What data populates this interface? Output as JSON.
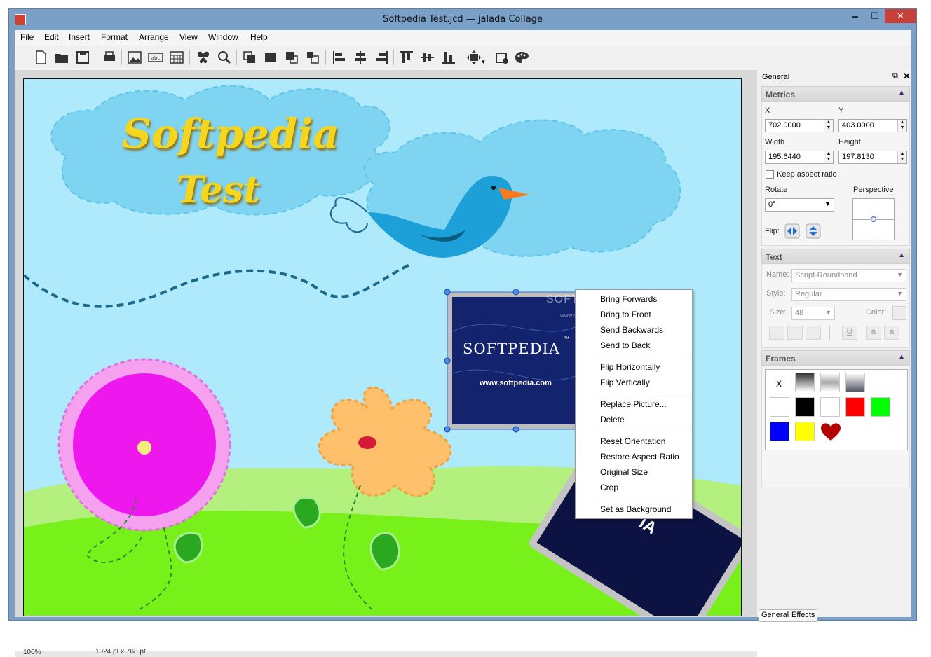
{
  "window": {
    "title": "Softpedia Test.jcd — jalada Collage",
    "min_label": "🗕",
    "max_label": "☐",
    "close_label": "✕"
  },
  "menubar": [
    "File",
    "Edit",
    "Insert",
    "Format",
    "Arrange",
    "View",
    "Window",
    "Help"
  ],
  "toolbar": {
    "icons": [
      "new-file-icon",
      "open-folder-icon",
      "save-icon",
      "print-icon",
      "insert-image-icon",
      "insert-text-icon",
      "insert-calendar-icon",
      "butterfly-icon",
      "magnifier-icon",
      "bring-forward-icon",
      "bring-front-icon",
      "send-backward-icon",
      "send-back-icon",
      "align-left-icon",
      "align-center-icon",
      "align-right-icon",
      "align-top-icon",
      "align-middle-icon",
      "align-bottom-icon",
      "fit-icon",
      "page-settings-icon",
      "palette-icon"
    ],
    "dropdown_arrow": "▾"
  },
  "canvas": {
    "title_line1": "Softpedia",
    "title_line2": "Test",
    "photo_text": "SOFTPEDIA",
    "photo_tm": "™",
    "photo_url": "www.softpedia.com",
    "watermark": "SOFTPEDIA",
    "watermark_url": "www.softpedia.com",
    "card2_text": "IA"
  },
  "context_menu": {
    "groups": [
      [
        "Bring Forwards",
        "Bring to Front",
        "Send Backwards",
        "Send to Back"
      ],
      [
        "Flip Horizontally",
        "Flip Vertically"
      ],
      [
        "Replace Picture...",
        "Delete"
      ],
      [
        "Reset Orientation",
        "Restore Aspect Ratio",
        "Original Size",
        "Crop"
      ],
      [
        "Set as Background"
      ]
    ]
  },
  "status": {
    "zoom": "100%",
    "size": "1024 pt x 768 pt"
  },
  "panel": {
    "title": "General",
    "float_icon": "⧉",
    "close_icon": "✕",
    "metrics": {
      "header": "Metrics",
      "x_label": "X",
      "y_label": "Y",
      "x_value": "702.0000",
      "y_value": "403.0000",
      "width_label": "Width",
      "height_label": "Height",
      "width_value": "195.6440",
      "height_value": "197.8130",
      "keep_aspect": "Keep aspect ratio",
      "keep_aspect_checked": false,
      "rotate_label": "Rotate",
      "rotate_value": "0°",
      "perspective_label": "Perspective",
      "flip_label": "Flip:"
    },
    "text": {
      "header": "Text",
      "name_label": "Name:",
      "name_value": "Script-Roundhand",
      "style_label": "Style:",
      "style_value": "Regular",
      "size_label": "Size:",
      "size_value": "48",
      "color_label": "Color:",
      "format_buttons": [
        "U",
        "a",
        "a"
      ]
    },
    "frames": {
      "header": "Frames",
      "none_label": "X",
      "swatches": [
        "#ffffff",
        "#000000",
        "#ffffff",
        "#ff0000",
        "#00ff00",
        "#0000ff",
        "#ffff00",
        "heart"
      ]
    },
    "tabs": [
      "General",
      "Effects"
    ]
  },
  "colors": {
    "sky": "#aeeafc",
    "cloud": "#7fd4f2",
    "grass_light": "#b4f07e",
    "grass": "#78f01a",
    "title_yellow": "#f5d61e",
    "close_red": "#c7403a"
  }
}
